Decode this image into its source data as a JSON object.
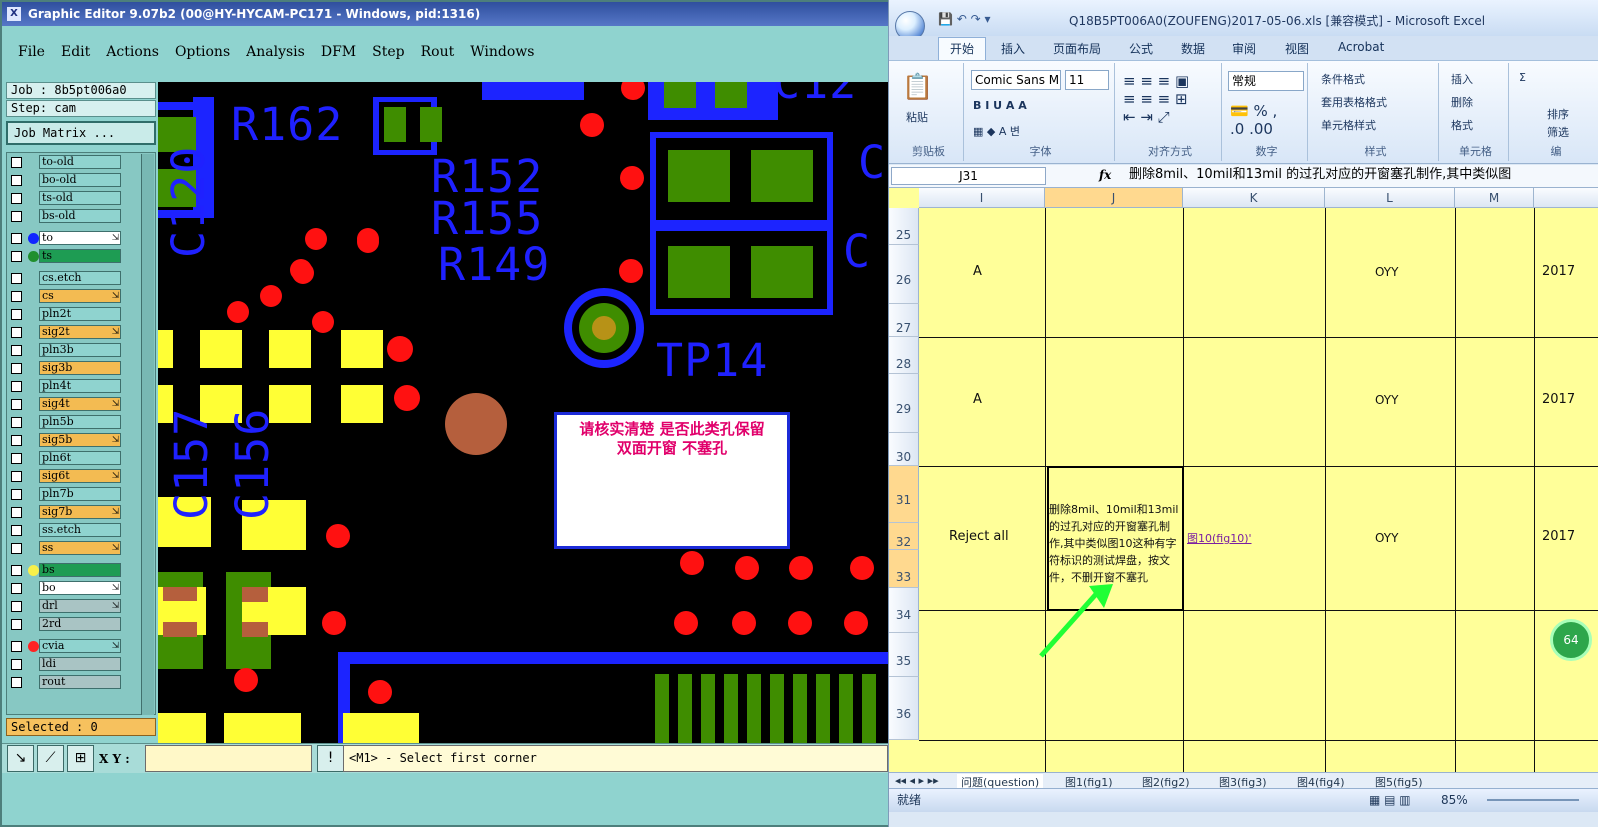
{
  "cam": {
    "title": "Graphic Editor 9.07b2 (00@HY-HYCAM-PC171 - Windows, pid:1316)",
    "menus": [
      "File",
      "Edit",
      "Actions",
      "Options",
      "Analysis",
      "DFM",
      "Step",
      "Rout",
      "Windows"
    ],
    "job": "Job : 8b5pt006a0",
    "step": "Step: cam",
    "job_matrix": "Job Matrix ...",
    "selected": "Selected : 0",
    "xy_label": "X Y :",
    "message": "<M1> - Select first corner",
    "layers": [
      {
        "name": "to-old",
        "bg": "#8fd3cf",
        "dot": ""
      },
      {
        "name": "bo-old",
        "bg": "#8fd3cf",
        "dot": ""
      },
      {
        "name": "ts-old",
        "bg": "#8fd3cf",
        "dot": ""
      },
      {
        "name": "bs-old",
        "bg": "#8fd3cf",
        "dot": ""
      },
      {
        "name": "to",
        "bg": "#ffffff",
        "dot": "#1026ff",
        "spin": true
      },
      {
        "name": "ts",
        "bg": "#1e9c53",
        "dot": "#208f2e"
      },
      {
        "name": "cs.etch",
        "bg": "#8fd3cf",
        "dot": ""
      },
      {
        "name": "cs",
        "bg": "#f3bb52",
        "dot": "",
        "spin": true
      },
      {
        "name": "pln2t",
        "bg": "#8fd3cf",
        "dot": ""
      },
      {
        "name": "sig2t",
        "bg": "#f3bb52",
        "dot": "",
        "spin": true
      },
      {
        "name": "pln3b",
        "bg": "#8fd3cf",
        "dot": ""
      },
      {
        "name": "sig3b",
        "bg": "#f3bb52",
        "dot": ""
      },
      {
        "name": "pln4t",
        "bg": "#8fd3cf",
        "dot": ""
      },
      {
        "name": "sig4t",
        "bg": "#f3bb52",
        "dot": "",
        "spin": true
      },
      {
        "name": "pln5b",
        "bg": "#8fd3cf",
        "dot": ""
      },
      {
        "name": "sig5b",
        "bg": "#f3bb52",
        "dot": "",
        "spin": true
      },
      {
        "name": "pln6t",
        "bg": "#8fd3cf",
        "dot": ""
      },
      {
        "name": "sig6t",
        "bg": "#f3bb52",
        "dot": "",
        "spin": true
      },
      {
        "name": "pln7b",
        "bg": "#8fd3cf",
        "dot": ""
      },
      {
        "name": "sig7b",
        "bg": "#f3bb52",
        "dot": "",
        "spin": true
      },
      {
        "name": "ss.etch",
        "bg": "#8fd3cf",
        "dot": ""
      },
      {
        "name": "ss",
        "bg": "#f3bb52",
        "dot": "",
        "spin": true
      },
      {
        "name": "bs",
        "bg": "#1e9c53",
        "dot": "#f8f04a"
      },
      {
        "name": "bo",
        "bg": "#ffffff",
        "dot": "",
        "spin": true
      },
      {
        "name": "drl",
        "bg": "#a9c4c4",
        "dot": "",
        "spin": true
      },
      {
        "name": "2rd",
        "bg": "#a9c4c4",
        "dot": ""
      },
      {
        "name": "cvia",
        "bg": "#8fd3cf",
        "dot": "#ff2323",
        "spin": true
      },
      {
        "name": "ldi",
        "bg": "#a9c4c4",
        "dot": ""
      },
      {
        "name": "rout",
        "bg": "#a9c4c4",
        "dot": ""
      }
    ],
    "board_labels": [
      "R162",
      "R152",
      "R155",
      "R149",
      "TP14",
      "C120",
      "C157",
      "C156",
      "C12",
      "C",
      "C"
    ],
    "note": "请核实清楚  是否此类孔保留\n双面开窗   不塞孔"
  },
  "excel": {
    "title": "Q18B5PT006A0(ZOUFENG)2017-05-06.xls  [兼容模式] - Microsoft Excel",
    "tabs": [
      "开始",
      "插入",
      "页面布局",
      "公式",
      "数据",
      "审阅",
      "视图",
      "Acrobat"
    ],
    "groups": [
      "剪贴板",
      "字体",
      "对齐方式",
      "数字",
      "样式",
      "单元格",
      "编"
    ],
    "font_name": "Comic Sans M",
    "font_size": "11",
    "number_format": "常规",
    "style_items": [
      "条件格式",
      "套用表格格式",
      "单元格样式"
    ],
    "cell_items": [
      "插入",
      "删除",
      "格式"
    ],
    "edit_items": [
      "排序",
      "筛选"
    ],
    "paste": "粘贴",
    "name_box": "J31",
    "formula": "删除8mil、10mil和13mil 的过孔对应的开窗塞孔制作,其中类似图",
    "columns": [
      "I",
      "J",
      "K",
      "L",
      "M"
    ],
    "rows": [
      "25",
      "26",
      "27",
      "28",
      "29",
      "30",
      "31",
      "32",
      "33",
      "34",
      "35",
      "36"
    ],
    "cells": {
      "i26": "A",
      "l26": "OYY",
      "m26": "2017",
      "i29": "A",
      "l29": "OYY",
      "m29": "2017",
      "i31": "Reject all",
      "j31": "删除8mil、10mil和13mil 的过孔对应的开窗塞孔制作,其中类似图10这种有字符标识的测试焊盘，按文件，不删开窗不塞孔",
      "k31": "图10(fig10)'",
      "l31": "OYY",
      "m31": "2017"
    },
    "sheet_tabs": [
      "问题(question)",
      "图1(fig1)",
      "图2(fig2)",
      "图3(fig3)",
      "图4(fig4)",
      "图5(fig5)"
    ],
    "status_ready": "就绪",
    "zoom": "85%",
    "badge": "64"
  }
}
